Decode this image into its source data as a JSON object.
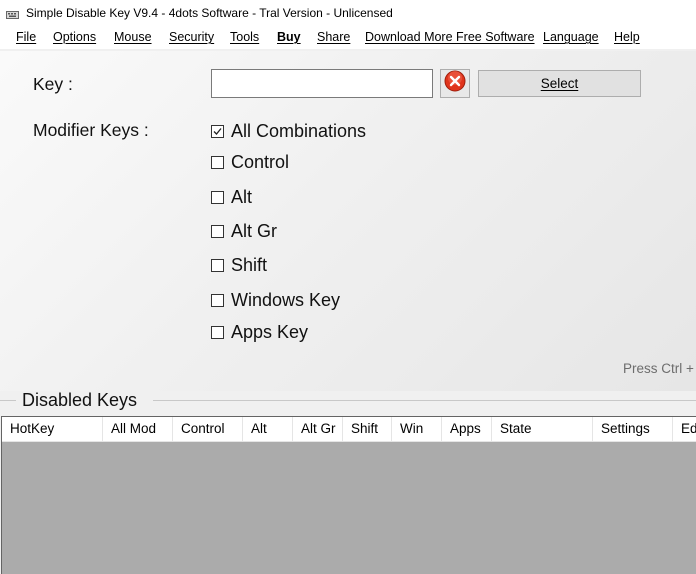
{
  "window": {
    "title": "Simple Disable Key V9.4 - 4dots Software - Tral Version - Unlicensed"
  },
  "menu": {
    "items": [
      {
        "label": "File"
      },
      {
        "label": "Options"
      },
      {
        "label": "Mouse"
      },
      {
        "label": "Security"
      },
      {
        "label": "Tools"
      },
      {
        "label": "Buy"
      },
      {
        "label": "Share"
      },
      {
        "label": "Download More Free Software"
      },
      {
        "label": "Language"
      },
      {
        "label": "Help"
      }
    ]
  },
  "form": {
    "key_label": "Key :",
    "key_value": "",
    "select_label": "Select",
    "modifier_label": "Modifier Keys :",
    "modifiers": [
      {
        "label": "All Combinations",
        "checked": true
      },
      {
        "label": "Control",
        "checked": false
      },
      {
        "label": "Alt",
        "checked": false
      },
      {
        "label": "Alt Gr",
        "checked": false
      },
      {
        "label": "Shift",
        "checked": false
      },
      {
        "label": "Windows Key",
        "checked": false
      },
      {
        "label": "Apps Key",
        "checked": false
      }
    ],
    "hint": "Press Ctrl + A"
  },
  "disabled_keys": {
    "title": "Disabled Keys",
    "columns": [
      "HotKey",
      "All Mod",
      "Control",
      "Alt",
      "Alt Gr",
      "Shift",
      "Win",
      "Apps",
      "State",
      "Settings",
      "Ed"
    ],
    "rows": []
  },
  "colors": {
    "clear_icon": "#e0341c",
    "grid_background": "#ababab"
  }
}
